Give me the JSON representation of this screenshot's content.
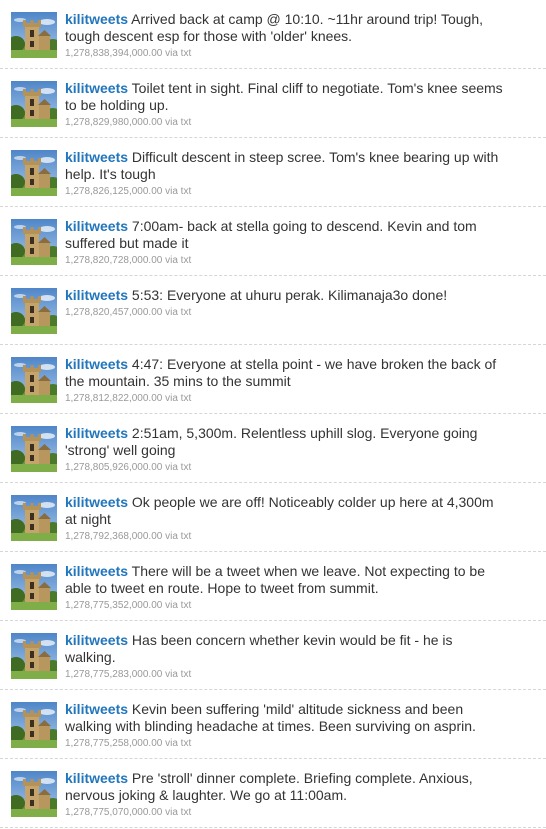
{
  "tweets": [
    {
      "username": "kilitweets",
      "text": "Arrived back at camp @ 10:10. ~11hr around trip! Tough, tough descent esp for those with 'older' knees.",
      "timestamp": "1,278,838,394,000.00",
      "source": "via txt"
    },
    {
      "username": "kilitweets",
      "text": "Toilet tent in sight. Final cliff to negotiate. Tom's knee seems to be holding up.",
      "timestamp": "1,278,829,980,000.00",
      "source": "via txt"
    },
    {
      "username": "kilitweets",
      "text": "Difficult descent in steep scree. Tom's knee bearing up with help. It's tough",
      "timestamp": "1,278,826,125,000.00",
      "source": "via txt"
    },
    {
      "username": "kilitweets",
      "text": "7:00am- back at stella going to descend. Kevin and tom suffered but made it",
      "timestamp": "1,278,820,728,000.00",
      "source": "via txt"
    },
    {
      "username": "kilitweets",
      "text": "5:53: Everyone at uhuru perak. Kilimanaja3o done!",
      "timestamp": "1,278,820,457,000.00",
      "source": "via txt"
    },
    {
      "username": "kilitweets",
      "text": "4:47: Everyone at stella point - we have broken the back of the mountain. 35 mins to the summit",
      "timestamp": "1,278,812,822,000.00",
      "source": "via txt"
    },
    {
      "username": "kilitweets",
      "text": "2:51am, 5,300m. Relentless uphill slog. Everyone going 'strong' well going",
      "timestamp": "1,278,805,926,000.00",
      "source": "via txt"
    },
    {
      "username": "kilitweets",
      "text": "Ok people we are off! Noticeably colder up here at 4,300m at night",
      "timestamp": "1,278,792,368,000.00",
      "source": "via txt"
    },
    {
      "username": "kilitweets",
      "text": "There will be a tweet when we leave. Not expecting to be able to tweet en route. Hope to tweet from summit.",
      "timestamp": "1,278,775,352,000.00",
      "source": "via txt"
    },
    {
      "username": "kilitweets",
      "text": "Has been concern whether kevin would be fit - he is walking.",
      "timestamp": "1,278,775,283,000.00",
      "source": "via txt"
    },
    {
      "username": "kilitweets",
      "text": "Kevin been suffering 'mild' altitude sickness and been walking with blinding headache at times. Been surviving on asprin.",
      "timestamp": "1,278,775,258,000.00",
      "source": "via txt"
    },
    {
      "username": "kilitweets",
      "text": "Pre 'stroll' dinner complete. Briefing complete. Anxious, nervous joking & laughter. We go at 11:00am.",
      "timestamp": "1,278,775,070,000.00",
      "source": "via txt"
    }
  ],
  "colors": {
    "username": "#2276bb",
    "text": "#333333",
    "meta": "#999999",
    "divider": "#d6d6d6"
  },
  "avatar_icon": "church-tower-photo-icon"
}
